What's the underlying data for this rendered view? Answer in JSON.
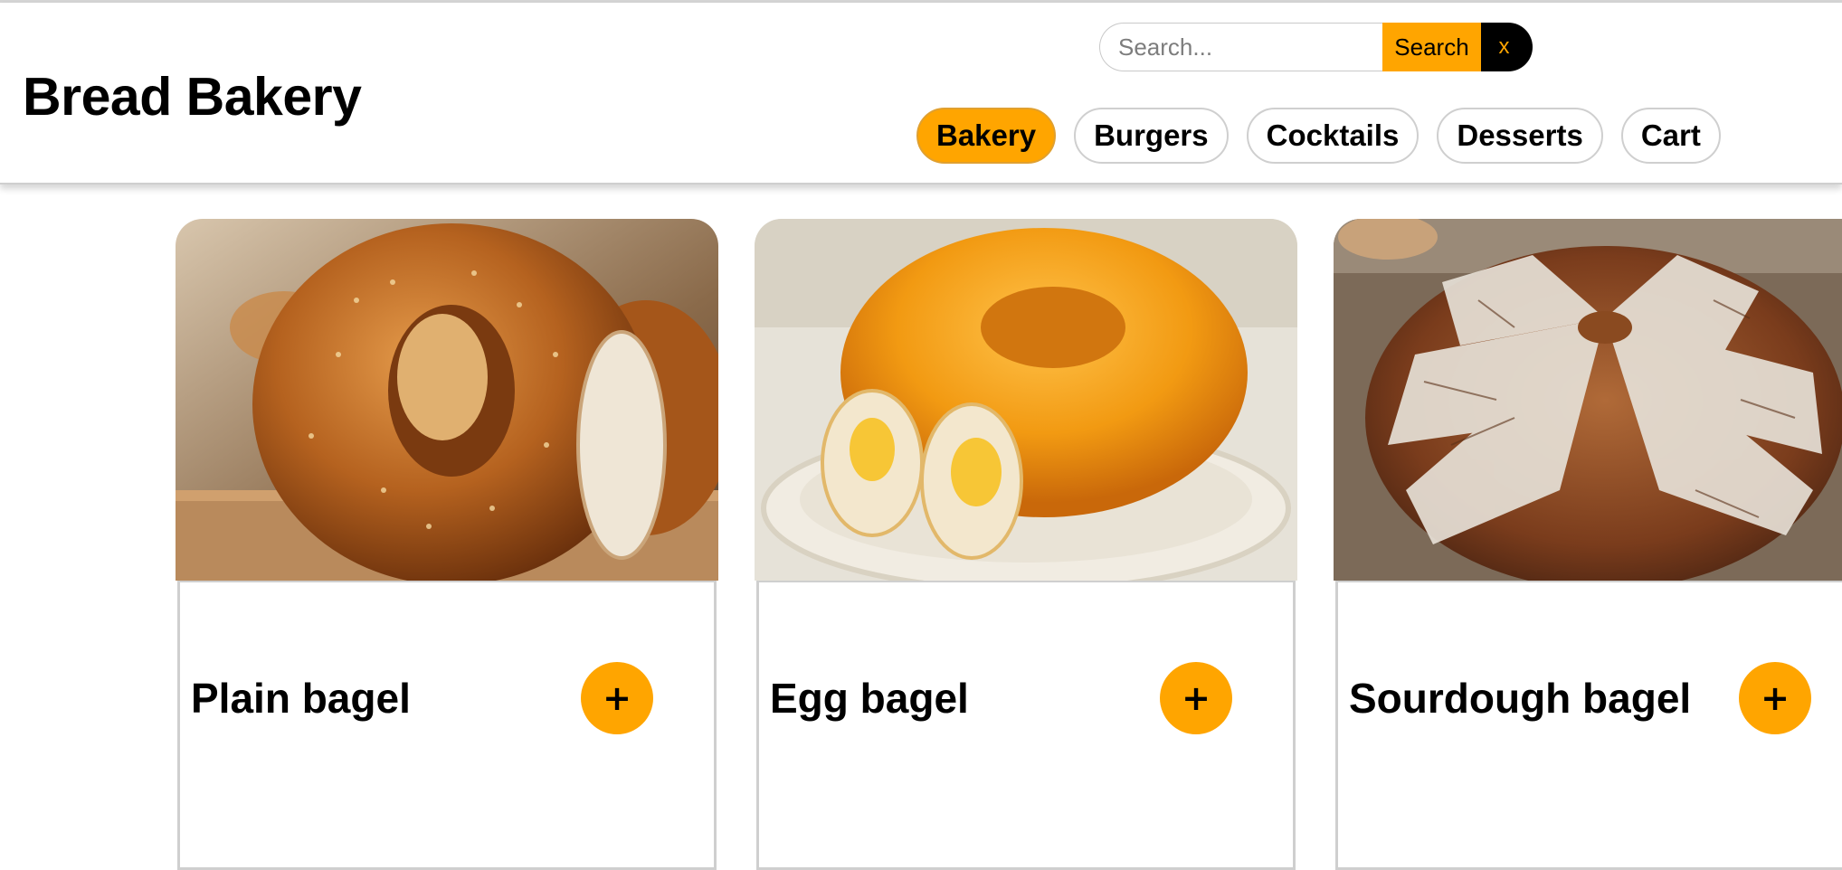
{
  "header": {
    "title": "Bread Bakery"
  },
  "search": {
    "placeholder": "Search...",
    "button_label": "Search",
    "clear_label": "x"
  },
  "nav": {
    "items": [
      {
        "label": "Bakery",
        "active": true
      },
      {
        "label": "Burgers",
        "active": false
      },
      {
        "label": "Cocktails",
        "active": false
      },
      {
        "label": "Desserts",
        "active": false
      },
      {
        "label": "Cart",
        "active": false
      }
    ]
  },
  "products": [
    {
      "name": "Plain bagel",
      "add_label": "+",
      "image": "plain-bagel-photo"
    },
    {
      "name": "Egg bagel",
      "add_label": "+",
      "image": "egg-bagel-photo"
    },
    {
      "name": "Sourdough bagel",
      "add_label": "+",
      "image": "sourdough-loaf-photo"
    }
  ],
  "colors": {
    "accent": "#ffa500",
    "dark": "#000000",
    "border": "#cfcfcf"
  }
}
